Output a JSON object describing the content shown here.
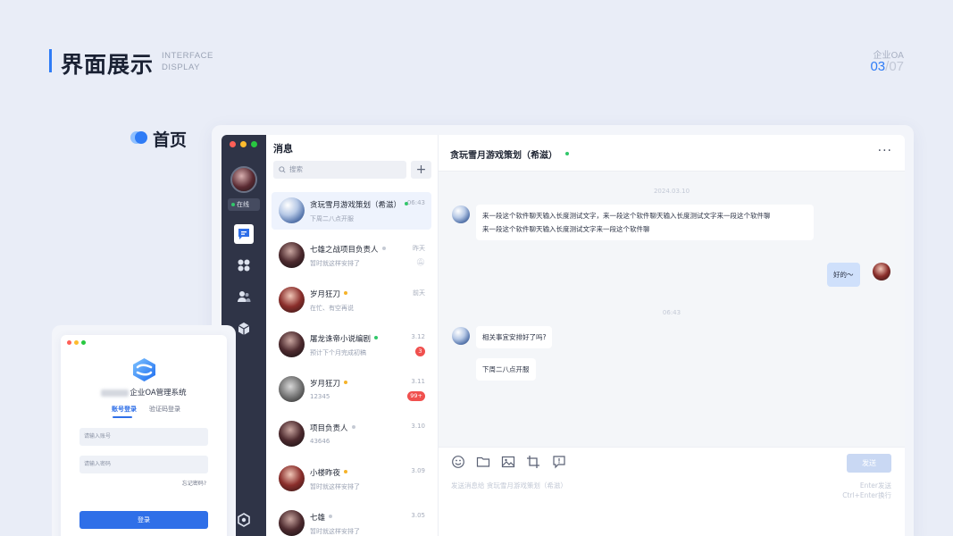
{
  "header": {
    "title": "界面展示",
    "subtitle_line1": "INTERFACE",
    "subtitle_line2": "DISPLAY",
    "corner_label": "企业OA",
    "page_current": "03",
    "page_separator": "/",
    "page_total": "07"
  },
  "section": {
    "title": "首页"
  },
  "app": {
    "sidebar": {
      "status": "在线",
      "icons": [
        "chat-icon",
        "apps-icon",
        "contacts-icon",
        "cube-icon",
        "settings-icon"
      ]
    },
    "list": {
      "title": "消息",
      "search_placeholder": "搜索",
      "add_label": "+",
      "conversations": [
        {
          "name": "贪玩雪月游戏策划（希滋）",
          "preview": "下周二八点开服",
          "time": "06:43",
          "status_color": "#31c76a",
          "selected": true
        },
        {
          "name": "七雄之战项目负责人",
          "preview": "暂时就这样安排了",
          "time": "昨天",
          "status_color": "#c5cad4",
          "muted": true
        },
        {
          "name": "岁月狂刀",
          "preview": "在忙、有空再说",
          "time": "前天",
          "status_color": "#f5b32a"
        },
        {
          "name": "屠龙诛帝小说编剧",
          "preview": "预计下个月完成初稿",
          "time": "3.12",
          "status_color": "#31c76a",
          "badge": "3"
        },
        {
          "name": "岁月狂刀",
          "preview": "12345",
          "time": "3.11",
          "status_color": "#f5b32a",
          "badge": "99+"
        },
        {
          "name": "项目负责人",
          "preview": "43646",
          "time": "3.10",
          "status_color": "#c5cad4"
        },
        {
          "name": "小楼昨夜",
          "preview": "暂时就这样安排了",
          "time": "3.09",
          "status_color": "#f5b32a"
        },
        {
          "name": "七雄",
          "preview": "暂时就这样安排了",
          "time": "3.05",
          "status_color": "#c5cad4"
        }
      ]
    },
    "chat": {
      "title": "贪玩雪月游戏策划（希滋）",
      "more": "···",
      "timestamp1": "2024.03.10",
      "msg1": "来一段这个软件聊天输入长度测试文字，来一段这个软件聊天输入长度测试文字来一段这个软件聊天一段这个软件聊天输入长度测试文字来一段这个软件聊",
      "msg1_line1": "来一段这个软件聊天输入长度测试文字，来一段这个软件聊天输入长度测试文字来一段这个软件聊",
      "msg1_line2": "来一段这个软件聊天输入长度测试文字来一段这个软件聊",
      "msg_me": "好的～",
      "timestamp2": "06:43",
      "msg2": "相关事宜安排好了吗?",
      "msg3": "下周二八点开服",
      "composer_placeholder": "发送消息给  贪玩雪月游戏策划（希滋）",
      "send_label": "发送",
      "hint1": "Enter发送",
      "hint2": "Ctrl+Enter换行"
    }
  },
  "login": {
    "brand_suffix": "企业OA管理系统",
    "tab_account": "账号登录",
    "tab_code": "验证码登录",
    "account_placeholder": "请输入账号",
    "password_placeholder": "请输入密码",
    "forgot": "忘记密码?",
    "login_button": "登录"
  },
  "colors": {
    "accent": "#2f7cf6",
    "sidebar": "#2f3447",
    "online": "#31c76a",
    "badge": "#f0504e"
  }
}
